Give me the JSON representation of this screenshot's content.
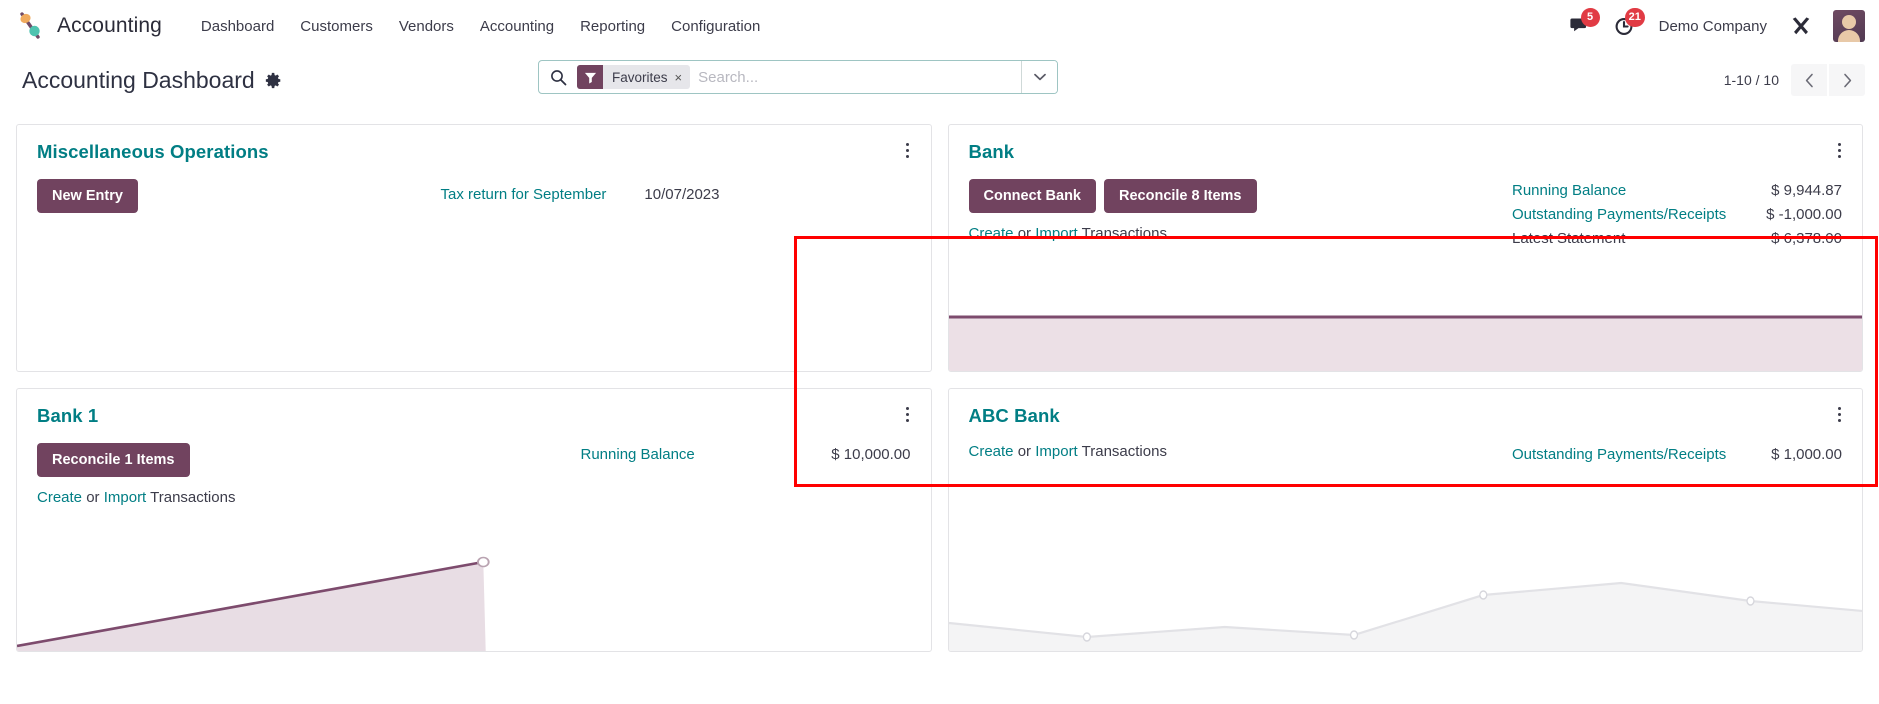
{
  "navbar": {
    "brand": "Accounting",
    "menu": [
      {
        "label": "Dashboard"
      },
      {
        "label": "Customers"
      },
      {
        "label": "Vendors"
      },
      {
        "label": "Accounting"
      },
      {
        "label": "Reporting"
      },
      {
        "label": "Configuration"
      }
    ],
    "messages_badge": "5",
    "activities_badge": "21",
    "company": "Demo Company"
  },
  "control_panel": {
    "title": "Accounting Dashboard",
    "search": {
      "facet_label": "Favorites",
      "facet_close": "×",
      "placeholder": "Search..."
    },
    "pager": {
      "text": "1-10 / 10",
      "prev": "‹",
      "next": "›"
    }
  },
  "colors": {
    "brand_purple": "#71435f",
    "link_teal": "#017e84",
    "badge_red": "#e13b44",
    "highlight_red": "#ff0000",
    "graph_line": "#7d4b6d",
    "graph_fill": "#ece0e6"
  },
  "cards": {
    "partial_left": {
      "ghost_text": ""
    },
    "partial_right": {
      "ghost_text": ""
    },
    "misc": {
      "title": "Miscellaneous Operations",
      "new_entry_label": "New Entry",
      "entry_name": "Tax return for September",
      "entry_date": "10/07/2023"
    },
    "bank": {
      "title": "Bank",
      "connect_label": "Connect Bank",
      "reconcile_label": "Reconcile 8 Items",
      "create_label": "Create",
      "or_label": "or",
      "import_label": "Import",
      "transactions_label": "Transactions",
      "stats": [
        {
          "label": "Running Balance",
          "value": "$ 9,944.87",
          "is_link": true
        },
        {
          "label": "Outstanding Payments/Receipts",
          "value": "$ -1,000.00",
          "is_link": true
        },
        {
          "label": "Latest Statement",
          "value": "$ 6,378.00",
          "is_link": false
        }
      ]
    },
    "bank1": {
      "title": "Bank 1",
      "reconcile_label": "Reconcile 1 Items",
      "create_label": "Create",
      "or_label": "or",
      "import_label": "Import",
      "transactions_label": "Transactions",
      "stats": [
        {
          "label": "Running Balance",
          "value": "$ 10,000.00",
          "is_link": true
        }
      ]
    },
    "abc_bank": {
      "title": "ABC Bank",
      "create_label": "Create",
      "or_label": "or",
      "import_label": "Import",
      "transactions_label": "Transactions",
      "stats": [
        {
          "label": "Outstanding Payments/Receipts",
          "value": "$ 1,000.00",
          "is_link": true
        }
      ]
    }
  }
}
